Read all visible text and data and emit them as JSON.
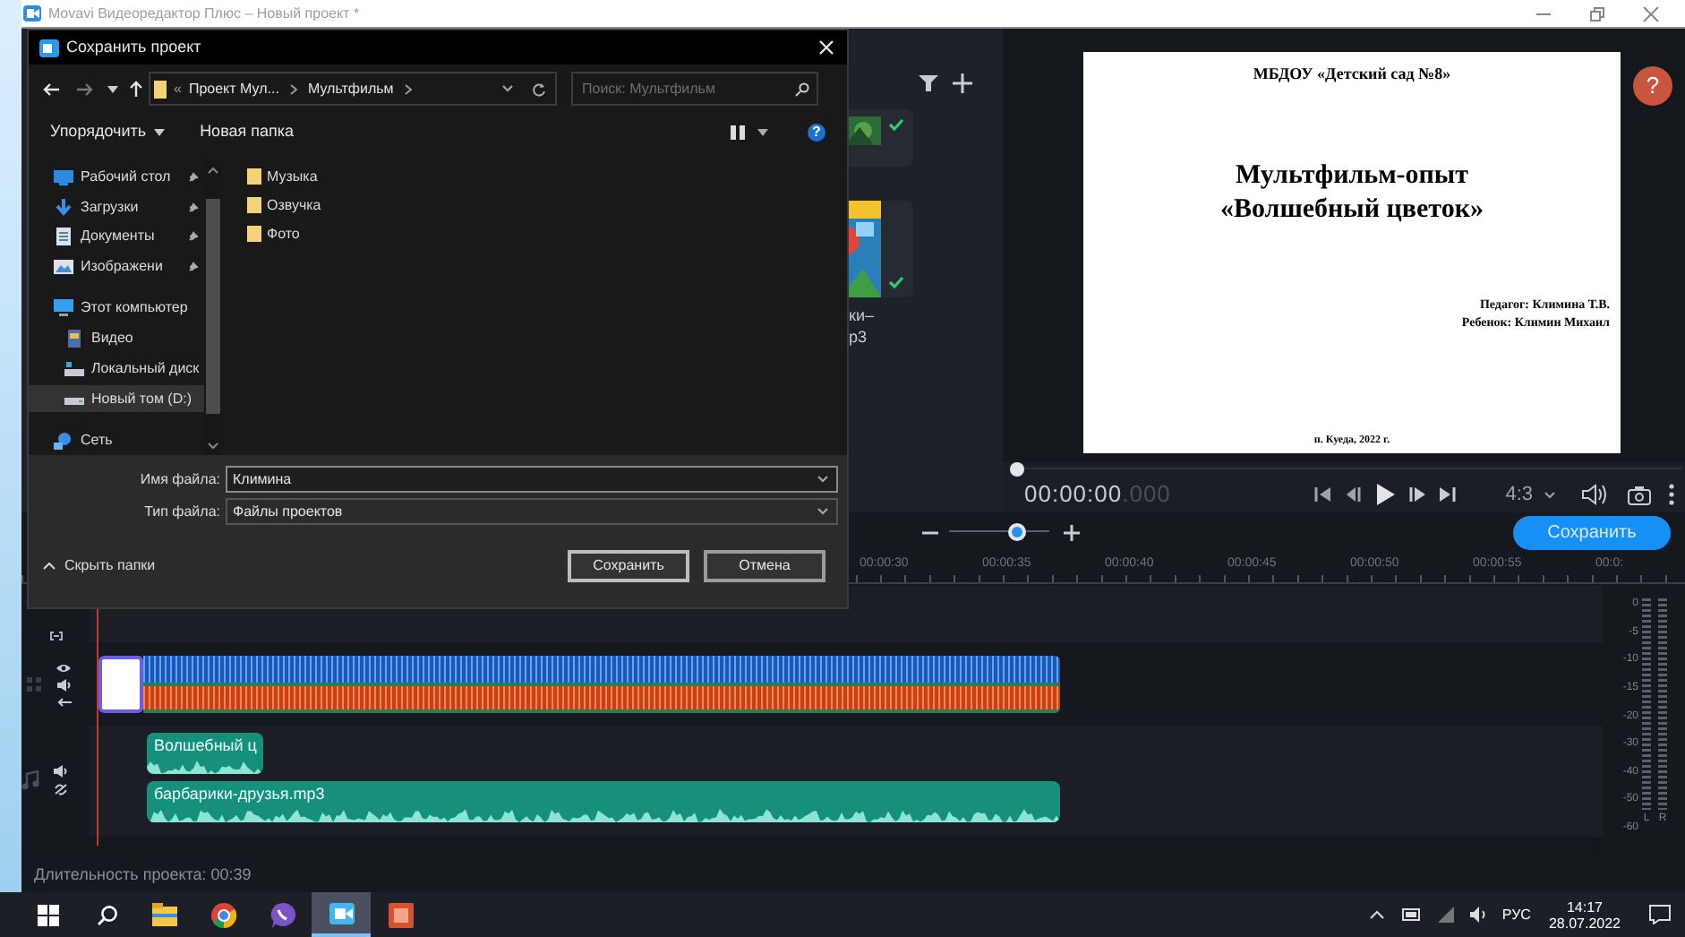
{
  "window": {
    "title": "Movavi Видеоредактор Плюс – Новый проект *"
  },
  "media": {
    "label_lines": [
      "ки–",
      "р3"
    ]
  },
  "preview": {
    "header": "МБДОУ «Детский сад №8»",
    "title_lines": [
      "Мультфильм-опыт",
      "«Волшебный цветок»"
    ],
    "credit_lines": [
      "Педагог: Климина Т.В.",
      "Ребенок: Климин Михаил"
    ],
    "footer": "п. Куеда, 2022 г.",
    "help": "?"
  },
  "player": {
    "seek": {
      "level": 0
    },
    "timecode": "00:00:00",
    "timecode_fraction": ".000",
    "aspect": "4:3"
  },
  "zoom": {
    "level": 0.68
  },
  "save_button": "Сохранить",
  "ruler": [
    "00:00:30",
    "00:00:35",
    "00:00:40",
    "00:00:45",
    "00:00:50",
    "00:00:55",
    "00:0:"
  ],
  "audio_clips": [
    {
      "name": "Волшебный ц"
    },
    {
      "name": "барбарики-друзья.mp3"
    }
  ],
  "meter": {
    "scale": [
      "0",
      "-5",
      "-10",
      "-15",
      "-20",
      "-30",
      "-40",
      "-50",
      "-60"
    ],
    "channels": [
      "L",
      "R"
    ]
  },
  "status": "Длительность проекта: 00:39",
  "dialog": {
    "title": "Сохранить проект",
    "path": [
      "«",
      "Проект Мул...",
      "Мультфильм"
    ],
    "search_placeholder": "Поиск: Мультфильм",
    "organize": "Упорядочить",
    "new_folder": "Новая папка",
    "help": "?",
    "nav": [
      {
        "label": "Рабочий стол",
        "kind": "desktop",
        "pinned": true,
        "selected": false
      },
      {
        "label": "Загрузки",
        "kind": "download",
        "pinned": true,
        "selected": false
      },
      {
        "label": "Документы",
        "kind": "document",
        "pinned": true,
        "selected": false
      },
      {
        "label": "Изображени",
        "kind": "pictures",
        "pinned": true,
        "selected": false
      },
      {
        "label": "Этот компьютер",
        "kind": "computer",
        "pinned": false,
        "selected": false,
        "children": [
          {
            "label": "Видео",
            "kind": "video",
            "selected": false
          },
          {
            "label": "Локальный диск",
            "kind": "disk",
            "selected": false
          },
          {
            "label": "Новый том (D:)",
            "kind": "drive",
            "selected": true
          }
        ]
      },
      {
        "label": "Сеть",
        "kind": "network",
        "pinned": false,
        "selected": false
      }
    ],
    "files": [
      {
        "name": "Музыка"
      },
      {
        "name": "Озвучка"
      },
      {
        "name": "Фото"
      }
    ],
    "fields": [
      {
        "label": "Имя файла:",
        "value": "Климина"
      },
      {
        "label": "Тип файла:",
        "value": "Файлы проектов"
      }
    ],
    "hide_folders": "Скрыть папки",
    "buttons": [
      {
        "label": "Сохранить",
        "kind": "save"
      },
      {
        "label": "Отмена",
        "kind": "cancel"
      }
    ]
  },
  "taskbar": {
    "apps": [
      {
        "kind": "explorer",
        "active": false
      },
      {
        "kind": "chrome",
        "active": false
      },
      {
        "kind": "viber",
        "active": false
      },
      {
        "kind": "movavi",
        "active": true
      },
      {
        "kind": "powerpoint",
        "active": false
      }
    ],
    "language": "РУС",
    "time": "14:17",
    "date": "28.07.2022"
  }
}
